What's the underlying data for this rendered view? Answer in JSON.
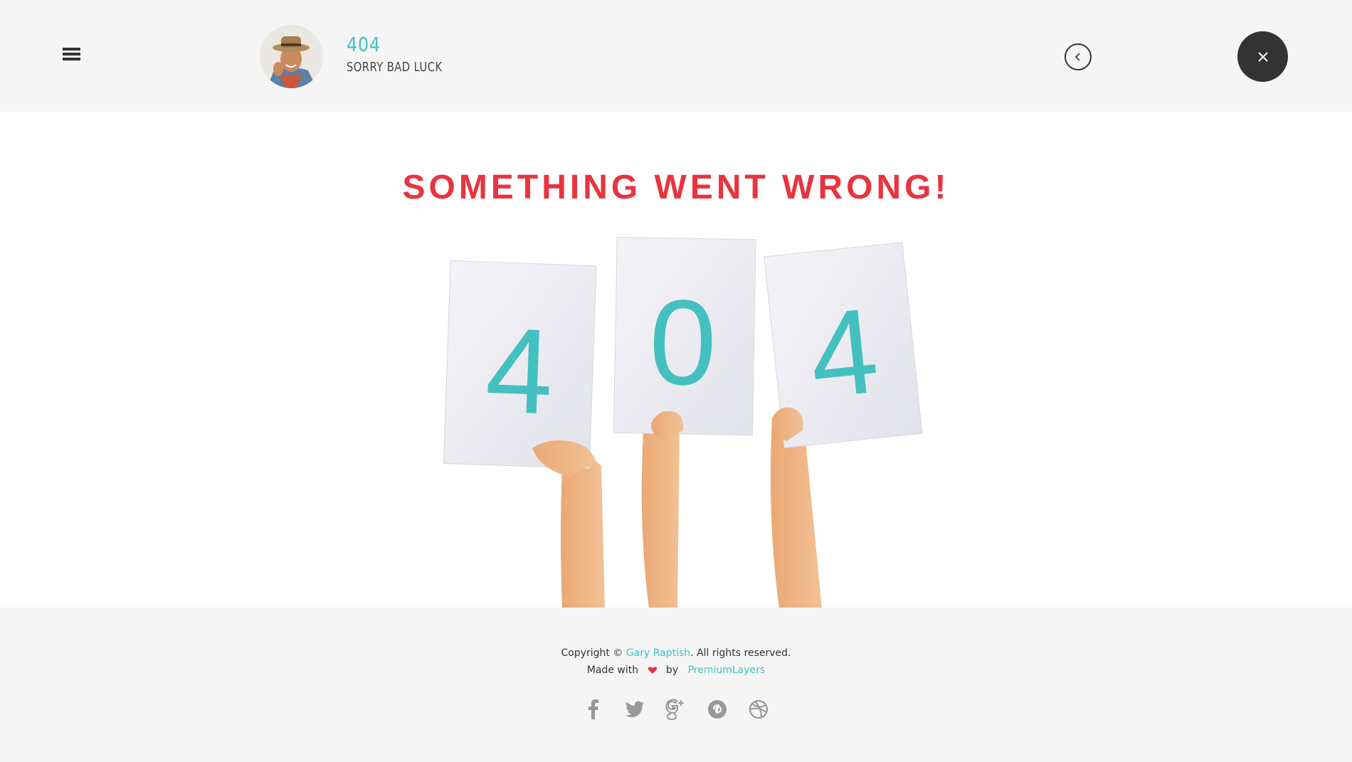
{
  "header": {
    "title": "404",
    "subtitle": "SORRY BAD LUCK"
  },
  "main": {
    "headline": "SOMETHING WENT WRONG!",
    "cards": [
      "4",
      "0",
      "4"
    ]
  },
  "footer": {
    "copyright_prefix": "Copyright © ",
    "author": "Gary Raptish",
    "copyright_suffix": ". All rights reserved.",
    "made_with": "Made with",
    "by": "by",
    "maker": "PremiumLayers",
    "socials": [
      "facebook-icon",
      "twitter-icon",
      "google-plus-icon",
      "pinterest-icon",
      "dribbble-icon"
    ]
  },
  "colors": {
    "accent": "#45c0c0",
    "headline": "#e8343f",
    "dark": "#333333",
    "panel": "#f5f5f5"
  }
}
